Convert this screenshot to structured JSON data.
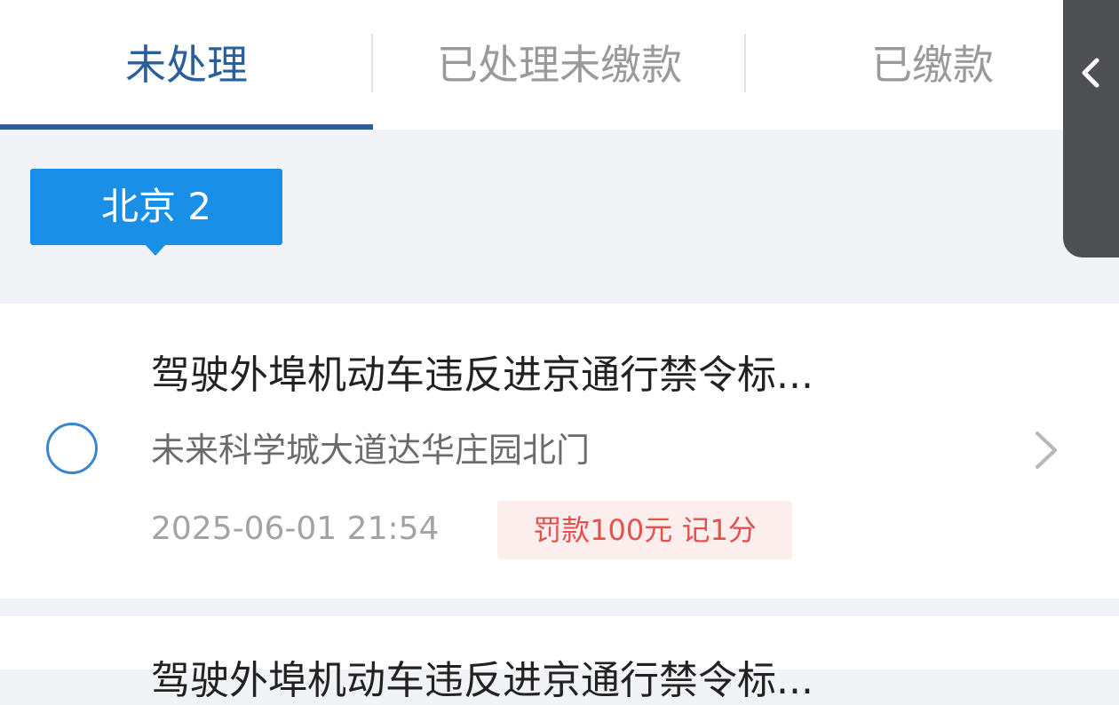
{
  "tabs": [
    {
      "label": "未处理",
      "active": true
    },
    {
      "label": "已处理未缴款",
      "active": false
    },
    {
      "label": "已缴款",
      "active": false
    }
  ],
  "city_badge": {
    "label": "北京 2"
  },
  "violations": [
    {
      "title": "驾驶外埠机动车违反进京通行禁令标...",
      "location": "未来科学城大道达华庄园北门",
      "datetime": "2025-06-01 21:54",
      "penalty": "罚款100元 记1分"
    },
    {
      "title": "驾驶外埠机动车违反进京通行禁令标..."
    }
  ],
  "icons": {
    "side_handle": "chevron-left-icon",
    "row_arrow": "chevron-right-icon",
    "select": "radio-circle-icon"
  },
  "colors": {
    "accent": "#2a5f9c",
    "badge": "#1a8fe8",
    "penalty_text": "#e2514d",
    "penalty_bg": "#fdeeee"
  }
}
